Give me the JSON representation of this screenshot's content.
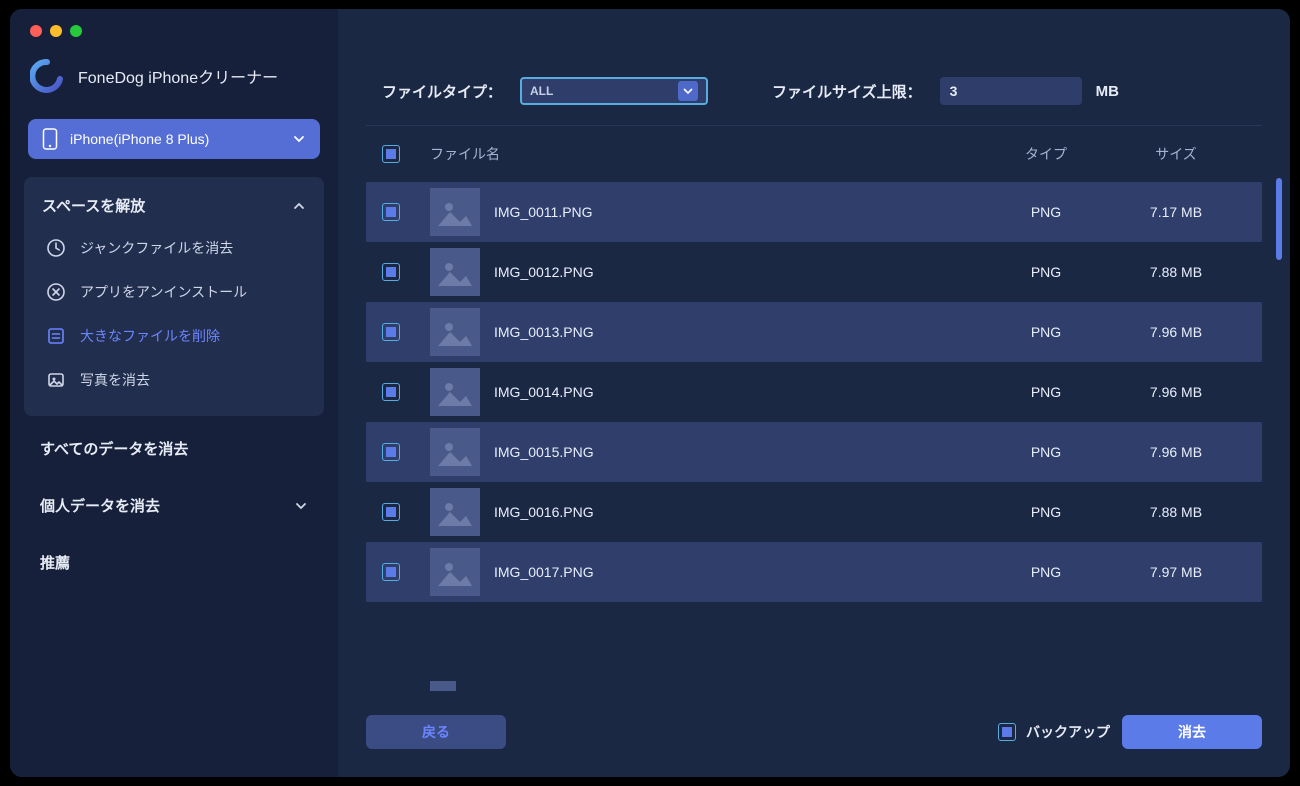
{
  "app": {
    "title": "FoneDog iPhoneクリーナー"
  },
  "device": {
    "label": "iPhone(iPhone 8 Plus)"
  },
  "sidebar": {
    "free_space_title": "スペースを解放",
    "items": {
      "junk": "ジャンクファイルを消去",
      "uninstall": "アプリをアンインストール",
      "large": "大きなファイルを削除",
      "photos": "写真を消去"
    },
    "erase_all": "すべてのデータを消去",
    "erase_private": "個人データを消去",
    "recommend": "推薦"
  },
  "filters": {
    "type_label": "ファイルタイプ：",
    "type_value": "ALL",
    "size_label": "ファイルサイズ上限：",
    "size_value": "3",
    "size_unit": "MB"
  },
  "table": {
    "headers": {
      "name": "ファイル名",
      "type": "タイプ",
      "size": "サイズ"
    },
    "rows": [
      {
        "name": "IMG_0011.PNG",
        "type": "PNG",
        "size": "7.17 MB"
      },
      {
        "name": "IMG_0012.PNG",
        "type": "PNG",
        "size": "7.88 MB"
      },
      {
        "name": "IMG_0013.PNG",
        "type": "PNG",
        "size": "7.96 MB"
      },
      {
        "name": "IMG_0014.PNG",
        "type": "PNG",
        "size": "7.96 MB"
      },
      {
        "name": "IMG_0015.PNG",
        "type": "PNG",
        "size": "7.96 MB"
      },
      {
        "name": "IMG_0016.PNG",
        "type": "PNG",
        "size": "7.88 MB"
      },
      {
        "name": "IMG_0017.PNG",
        "type": "PNG",
        "size": "7.97 MB"
      }
    ]
  },
  "footer": {
    "back": "戻る",
    "backup": "バックアップ",
    "erase": "消去"
  }
}
